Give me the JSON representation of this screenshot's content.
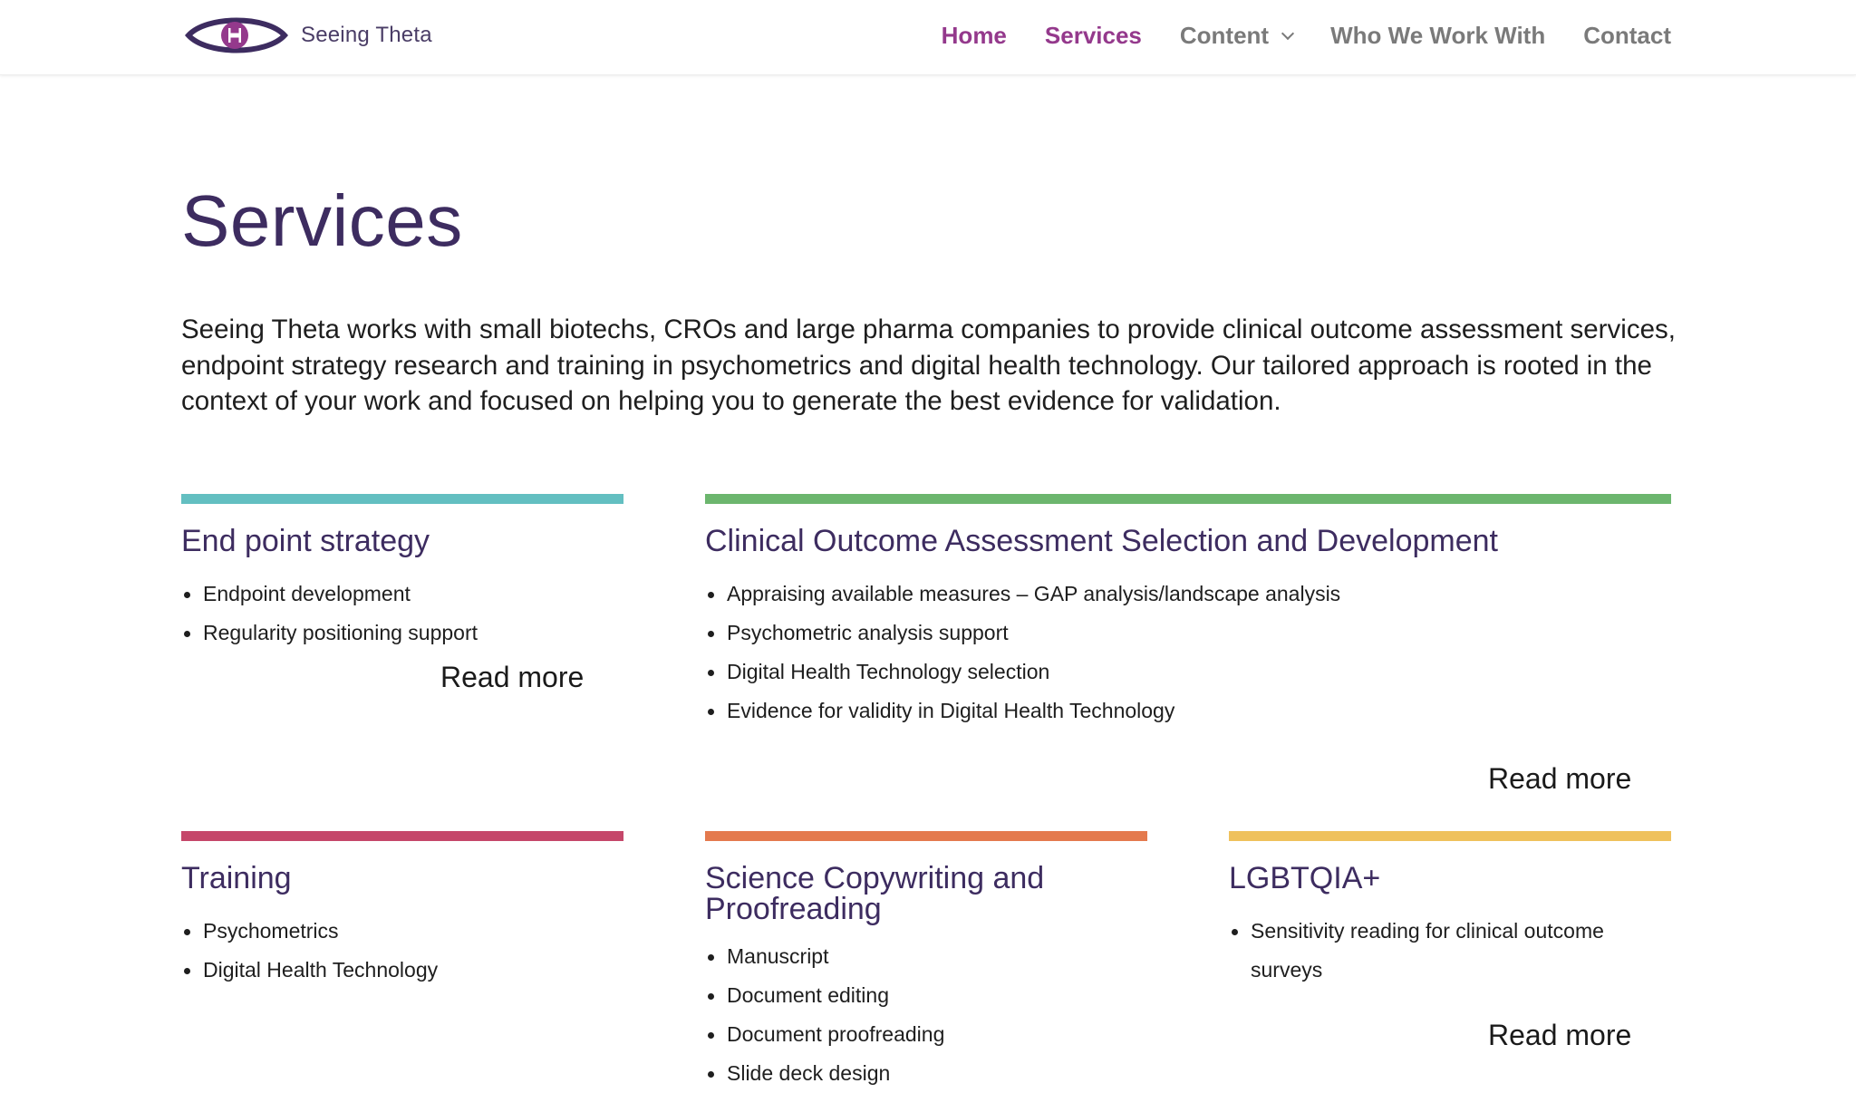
{
  "header": {
    "logo_text": "Seeing Theta",
    "nav": [
      {
        "label": "Home"
      },
      {
        "label": "Services"
      },
      {
        "label": "Content"
      },
      {
        "label": "Who We Work With"
      },
      {
        "label": "Contact"
      }
    ]
  },
  "main": {
    "title": "Services",
    "intro": "Seeing Theta works with small biotechs, CROs and large pharma companies to provide clinical outcome assessment services, endpoint strategy research and training in psychometrics and digital health technology. Our tailored approach is rooted in the context of your work and focused on helping you to generate the best evidence for validation.",
    "cards": [
      {
        "title": "End point strategy",
        "items": [
          "Endpoint development",
          "Regularity positioning support"
        ],
        "read_more": "Read more"
      },
      {
        "title": "Clinical Outcome Assessment Selection and Development",
        "items": [
          "Appraising available measures – GAP analysis/landscape analysis",
          "Psychometric analysis support",
          "Digital Health Technology selection",
          "Evidence for validity in Digital Health Technology"
        ],
        "read_more": "Read more"
      },
      {
        "title": "Training",
        "items": [
          "Psychometrics",
          "Digital Health Technology"
        ]
      },
      {
        "title": "Science Copywriting and Proofreading",
        "items": [
          "Manuscript",
          "Document editing",
          "Document proofreading",
          "Slide deck design"
        ]
      },
      {
        "title": "LGBTQIA+",
        "items": [
          "Sensitivity reading for clinical outcome surveys"
        ],
        "read_more": "Read more"
      }
    ]
  },
  "colors": {
    "brand_purple": "#3d2c60",
    "nav_active": "#94398c",
    "nav_inactive": "#7a7a7a",
    "endpoint_bar": "#63bfc1",
    "coa_bar": "#6cb66e",
    "training_bar": "#c5476a",
    "copywriting_bar": "#e47a4e",
    "lgbtqia_bar": "#efc15c"
  },
  "icons": {
    "logo": "eye-logo-icon",
    "dropdown": "chevron-down-icon"
  }
}
